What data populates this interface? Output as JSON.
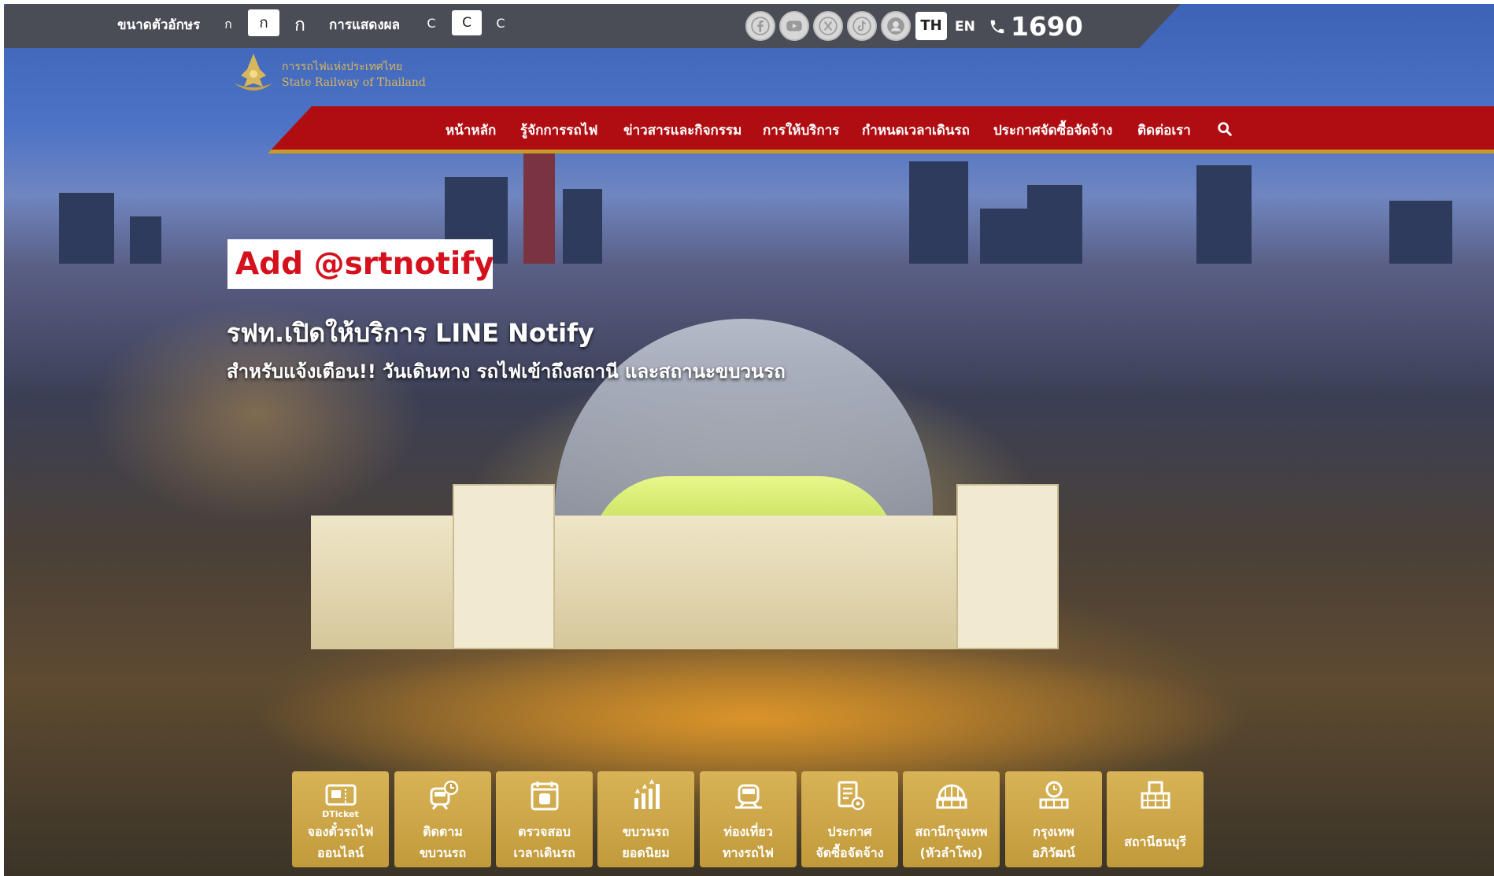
{
  "topbar": {
    "font_size_label": "ขนาดตัวอักษร",
    "font_size_options": [
      "ก",
      "ก",
      "ก"
    ],
    "display_label": "การแสดงผล",
    "display_options": [
      "C",
      "C",
      "C"
    ],
    "social_icons": [
      "facebook-icon",
      "youtube-icon",
      "x-icon",
      "tiktok-icon",
      "user-icon"
    ],
    "lang_th": "TH",
    "lang_en": "EN",
    "hotline": "1690"
  },
  "logo": {
    "name_th": "การรถไฟแห่งประเทศไทย",
    "name_en": "State Railway of Thailand"
  },
  "nav": {
    "items": [
      "หน้าหลัก",
      "รู้จักการรถไฟ",
      "ข่าวสารและกิจกรรม",
      "การให้บริการ",
      "กำหนดเวลาเดินรถ",
      "ประกาศจัดซื้อจัดจ้าง",
      "ติดต่อเรา"
    ]
  },
  "promo": {
    "badge": "Add @srtnotify",
    "title": "รฟท.เปิดให้บริการ LINE Notify",
    "subtitle": "สำหรับแจ้งเตือน!! วันเดินทาง รถไฟเข้าถึงสถานี และสถานะขบวนรถ"
  },
  "tiles": [
    {
      "line1": "จองตั๋วรถไฟ",
      "line2": "ออนไลน์",
      "icon": "ticket-icon",
      "sub": "DTicket"
    },
    {
      "line1": "ติดตาม",
      "line2": "ขบวนรถ",
      "icon": "train-clock-icon"
    },
    {
      "line1": "ตรวจสอบ",
      "line2": "เวลาเดินรถ",
      "icon": "train-calendar-icon"
    },
    {
      "line1": "ขบวนรถ",
      "line2": "ยอดนิยม",
      "icon": "popular-chart-icon"
    },
    {
      "line1": "ท่องเที่ยว",
      "line2": "ทางรถไฟ",
      "icon": "travel-train-icon"
    },
    {
      "line1": "ประกาศ",
      "line2": "จัดซื้อจัดจ้าง",
      "icon": "procurement-icon"
    },
    {
      "line1": "สถานีกรุงเทพ",
      "line2": "(หัวลำโพง)",
      "icon": "station-dome-icon"
    },
    {
      "line1": "กรุงเทพ",
      "line2": "อภิวัฒน์",
      "icon": "station-clock-icon"
    },
    {
      "line1": "สถานีธนบุรี",
      "line2": "",
      "icon": "station-building-icon"
    }
  ],
  "colors": {
    "topbar": "#4a4d55",
    "nav_red": "#b00d12",
    "gold": "#c99a25",
    "tile_gold": "#d0a94c",
    "promo_red": "#d4111c"
  }
}
